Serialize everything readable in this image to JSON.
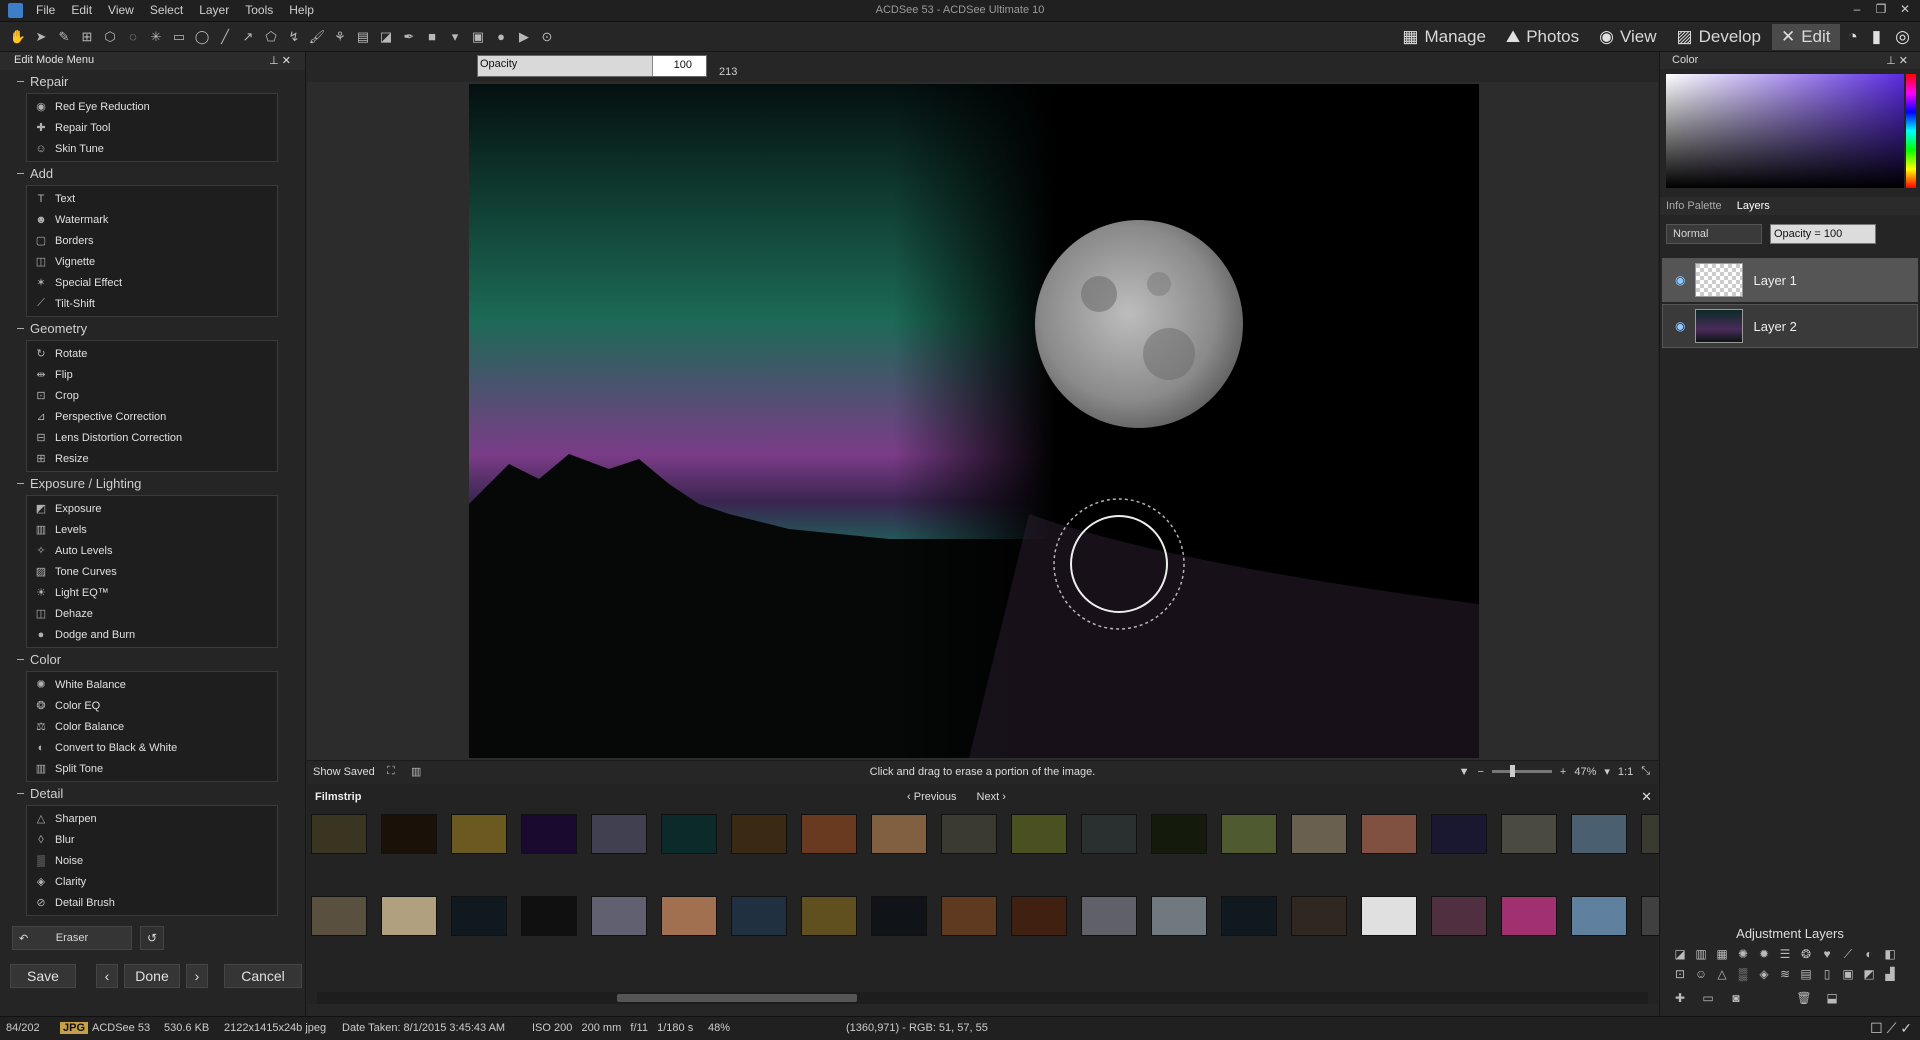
{
  "window": {
    "title": "ACDSee 53 - ACDSee Ultimate 10"
  },
  "menu": [
    "File",
    "Edit",
    "View",
    "Select",
    "Layer",
    "Tools",
    "Help"
  ],
  "modes": [
    {
      "label": "Manage",
      "icon": "grid-icon",
      "active": false
    },
    {
      "label": "Photos",
      "icon": "photos-icon",
      "active": false
    },
    {
      "label": "View",
      "icon": "eye-icon",
      "active": false
    },
    {
      "label": "Develop",
      "icon": "develop-icon",
      "active": false
    },
    {
      "label": "Edit",
      "icon": "edit-icon",
      "active": true
    }
  ],
  "edit_menu": {
    "title": "Edit Mode Menu",
    "sections": [
      {
        "title": "Repair",
        "items": [
          "Red Eye Reduction",
          "Repair Tool",
          "Skin Tune"
        ]
      },
      {
        "title": "Add",
        "items": [
          "Text",
          "Watermark",
          "Borders",
          "Vignette",
          "Special Effect",
          "Tilt-Shift"
        ]
      },
      {
        "title": "Geometry",
        "items": [
          "Rotate",
          "Flip",
          "Crop",
          "Perspective Correction",
          "Lens Distortion Correction",
          "Resize"
        ]
      },
      {
        "title": "Exposure / Lighting",
        "items": [
          "Exposure",
          "Levels",
          "Auto Levels",
          "Tone Curves",
          "Light EQ™",
          "Dehaze",
          "Dodge and Burn"
        ]
      },
      {
        "title": "Color",
        "items": [
          "White Balance",
          "Color EQ",
          "Color Balance",
          "Convert to Black & White",
          "Split Tone"
        ]
      },
      {
        "title": "Detail",
        "items": [
          "Sharpen",
          "Blur",
          "Noise",
          "Clarity",
          "Detail Brush"
        ]
      }
    ]
  },
  "tool_panel": {
    "active_tool": "Eraser",
    "save": "Save",
    "done": "Done",
    "cancel": "Cancel"
  },
  "options": {
    "opacity_label": "Opacity",
    "opacity_value": "100",
    "brush_size": "213"
  },
  "canvas_status": {
    "show_saved": "Show Saved",
    "hint": "Click and drag to erase a portion of the image.",
    "zoom": "47%",
    "ratio": "1:1"
  },
  "filmstrip": {
    "title": "Filmstrip",
    "previous": "Previous",
    "next": "Next"
  },
  "color_panel": {
    "title": "Color"
  },
  "layers_panel": {
    "tabs": [
      "Info Palette",
      "Layers"
    ],
    "blend_mode": "Normal",
    "opacity": "Opacity = 100",
    "layers": [
      {
        "name": "Layer 1",
        "selected": true
      },
      {
        "name": "Layer 2",
        "selected": false
      }
    ],
    "adjustment_title": "Adjustment Layers"
  },
  "statusbar": {
    "index": "84/202",
    "format": "JPG",
    "filename": "ACDSee 53",
    "size": "530.6 KB",
    "dimensions": "2122x1415x24b jpeg",
    "date": "Date Taken: 8/1/2015 3:45:43 AM",
    "exif": "ISO 200   200 mm   f/11   1/180 s",
    "zoom": "48%",
    "pixel": "(1360,971) - RGB: 51, 57, 55"
  }
}
